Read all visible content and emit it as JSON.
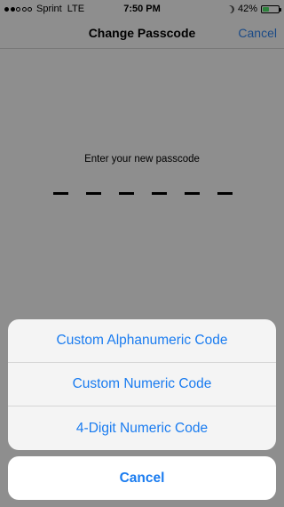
{
  "status_bar": {
    "carrier": "Sprint",
    "network": "LTE",
    "time": "7:50 PM",
    "battery_percent": "42%",
    "battery_level": 0.42,
    "signal_bars_filled": 2,
    "signal_bars_total": 5
  },
  "nav": {
    "title": "Change Passcode",
    "cancel_label": "Cancel"
  },
  "passcode": {
    "prompt": "Enter your new passcode",
    "digit_count": 6,
    "entered": 0
  },
  "action_sheet": {
    "options": [
      {
        "label": "Custom Alphanumeric Code"
      },
      {
        "label": "Custom Numeric Code"
      },
      {
        "label": "4-Digit Numeric Code"
      }
    ],
    "cancel_label": "Cancel"
  },
  "colors": {
    "accent": "#1a7cf0",
    "battery_green": "#4cd964"
  }
}
